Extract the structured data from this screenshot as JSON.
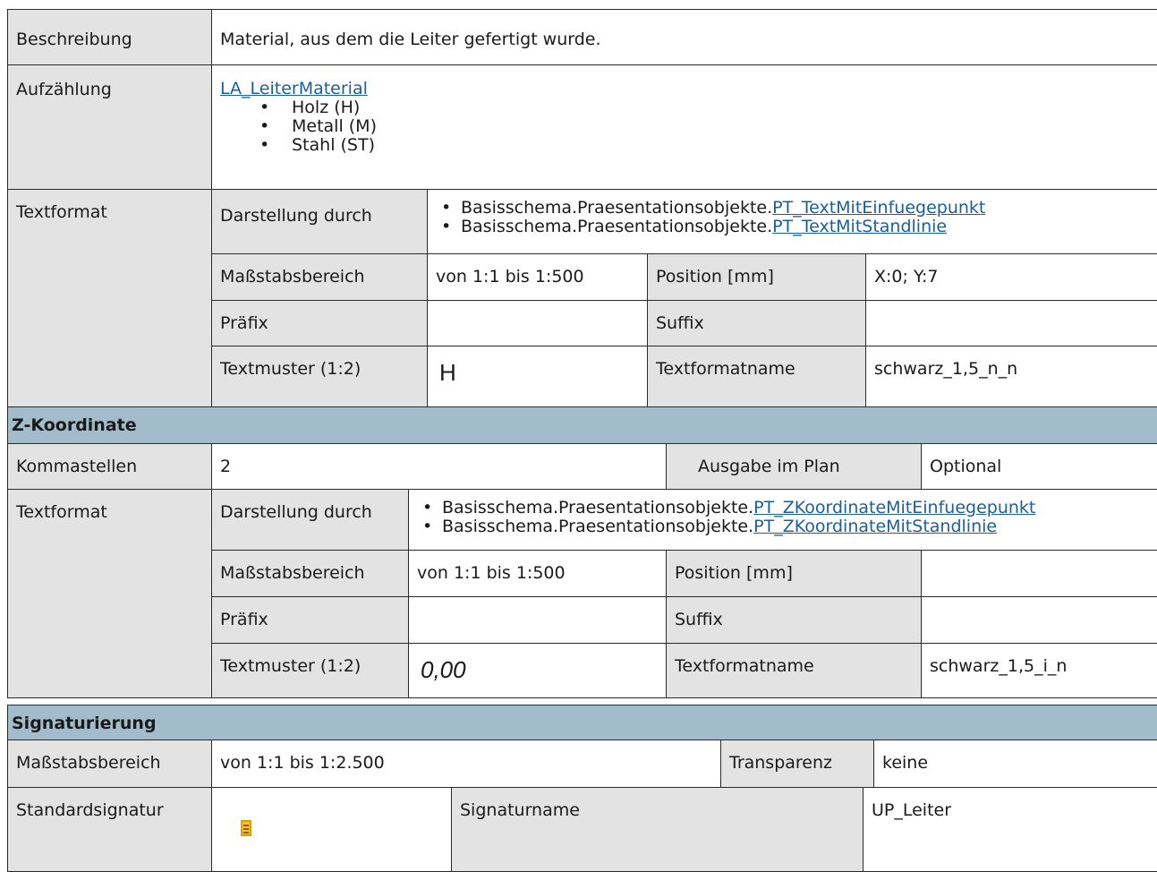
{
  "beschreibung": {
    "label": "Beschreibung",
    "value": "Material, aus dem die Leiter gefertigt wurde."
  },
  "aufzaehlung": {
    "label": "Aufzählung",
    "link": "LA_LeiterMaterial",
    "items": [
      "Holz (H)",
      "Metall (M)",
      "Stahl (ST)"
    ]
  },
  "textformat1": {
    "label": "Textformat",
    "darstellung_label": "Darstellung durch",
    "darstellung_prefix": "Basisschema.Praesentationsobjekte.",
    "darstellung_links": [
      "PT_TextMitEinfuegepunkt",
      "PT_TextMitStandlinie"
    ],
    "massstab_label": "Maßstabsbereich",
    "massstab_value": "von 1:1 bis 1:500",
    "position_label": "Position [mm]",
    "position_value": "X:0; Y:7",
    "praefix_label": "Präfix",
    "praefix_value": "",
    "suffix_label": "Suffix",
    "suffix_value": "",
    "textmuster_label": "Textmuster (1:2)",
    "textmuster_value": "H",
    "textformatname_label": "Textformatname",
    "textformatname_value": "schwarz_1,5_n_n"
  },
  "zkoordinate": {
    "section_title": "Z-Koordinate",
    "kommastellen_label": "Kommastellen",
    "kommastellen_value": "2",
    "ausgabe_label": "Ausgabe im Plan",
    "ausgabe_value": "Optional",
    "textformat_label": "Textformat",
    "darstellung_label": "Darstellung durch",
    "darstellung_prefix": "Basisschema.Praesentationsobjekte.",
    "darstellung_links": [
      "PT_ZKoordinateMitEinfuegepunkt",
      "PT_ZKoordinateMitStandlinie"
    ],
    "massstab_label": "Maßstabsbereich",
    "massstab_value": "von 1:1 bis 1:500",
    "position_label": "Position [mm]",
    "position_value": "",
    "praefix_label": "Präfix",
    "praefix_value": "",
    "suffix_label": "Suffix",
    "suffix_value": "",
    "textmuster_label": "Textmuster (1:2)",
    "textmuster_value": "0,00",
    "textformatname_label": "Textformatname",
    "textformatname_value": "schwarz_1,5_i_n"
  },
  "signaturierung": {
    "section_title": "Signaturierung",
    "massstab_label": "Maßstabsbereich",
    "massstab_value": "von 1:1 bis 1:2.500",
    "transparenz_label": "Transparenz",
    "transparenz_value": "keine",
    "standardsignatur_label": "Standardsignatur",
    "standardsignatur_icon": "ladder-icon",
    "signaturname_label": "Signaturname",
    "signaturname_value": "UP_Leiter"
  },
  "bullet": "•",
  "colors": {
    "label_bg": "#e3e3e3",
    "section_bg": "#a3bccc",
    "link": "#1a5f99",
    "ladder": "#f3c23a"
  }
}
